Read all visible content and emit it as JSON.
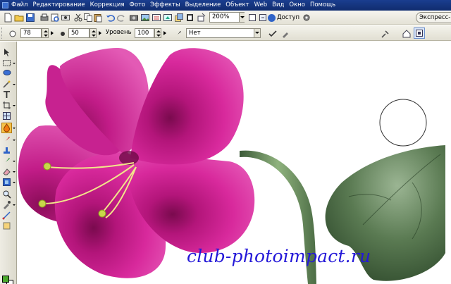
{
  "menu": {
    "items": [
      "Файл",
      "Редактирование",
      "Коррекция",
      "Фото",
      "Эффекты",
      "Выделение",
      "Объект",
      "Web",
      "Вид",
      "Окно",
      "Помощь"
    ]
  },
  "toolbar": {
    "zoom_value": "200%",
    "access_label": "Доступ",
    "express_label": "Экспресс-ко"
  },
  "attributes": {
    "size_value": "78",
    "soft_edge_value": "50",
    "level_label": "Уровень",
    "level_value": "100",
    "mode_value": "Нет"
  },
  "canvas": {
    "watermark": "club-photoimpact.ru"
  },
  "colors": {
    "foreground": "#4aa82c",
    "background": "#ffffff",
    "petal": "#d8299c",
    "leaf": "#4e6b46",
    "watermark": "#2418d8"
  },
  "tools": [
    "pick-icon",
    "selection-icon",
    "lasso-icon",
    "magic-wand-icon",
    "text-icon",
    "crop-icon",
    "transform-icon",
    "dodge-icon",
    "brush-icon",
    "stamp-icon",
    "clone-icon",
    "eraser-icon",
    "fill-icon",
    "zoom-icon",
    "eyedropper-icon",
    "path-icon"
  ]
}
